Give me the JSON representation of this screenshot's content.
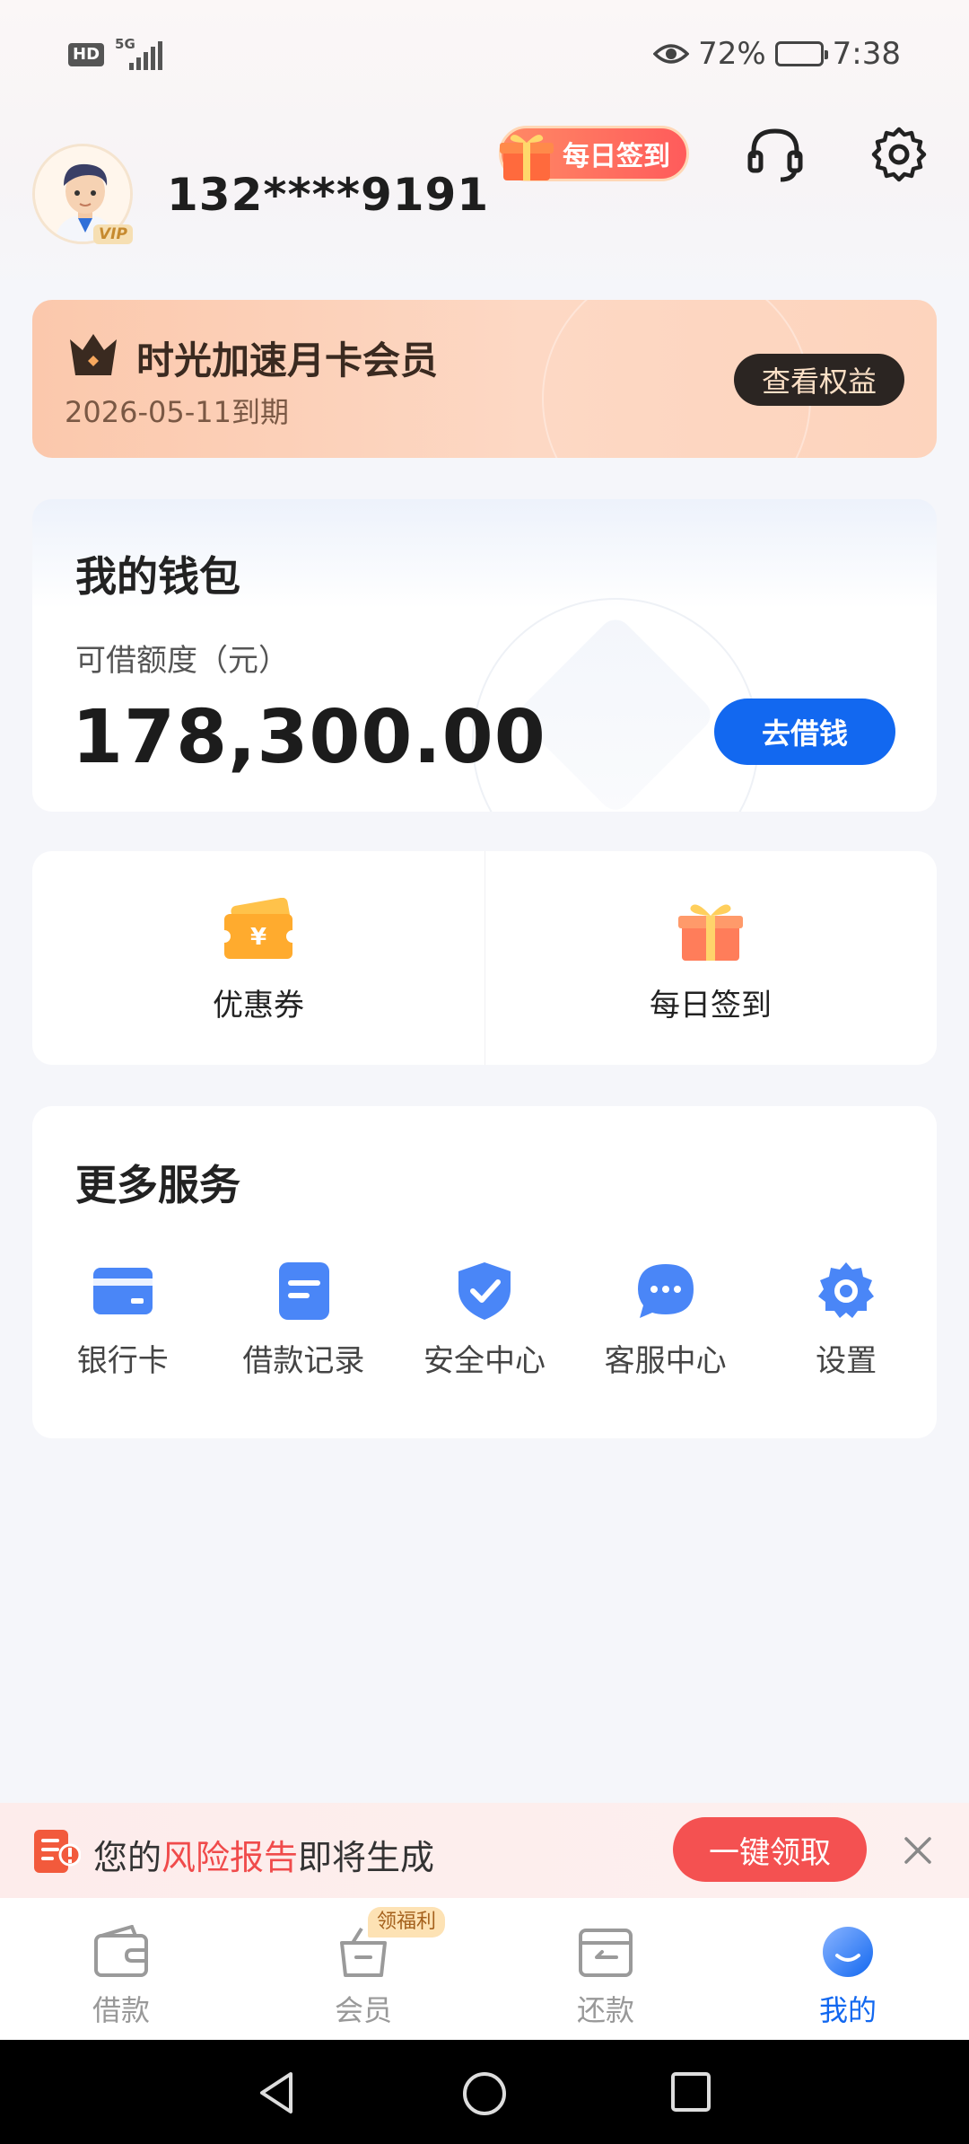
{
  "status_bar": {
    "hd": "HD",
    "network": "5G",
    "battery_percent": "72%",
    "time": "7:38",
    "battery_level": 0.72
  },
  "header": {
    "phone": "132****9191",
    "vip_tag": "VIP",
    "checkin_label": "每日签到"
  },
  "member": {
    "title": "时光加速月卡会员",
    "expire": "2026-05-11到期",
    "rights_button": "查看权益"
  },
  "wallet": {
    "title": "我的钱包",
    "credit_label": "可借额度（元）",
    "amount": "178,300.00",
    "borrow_button": "去借钱"
  },
  "quick": [
    {
      "label": "优惠券",
      "icon": "coupon-icon"
    },
    {
      "label": "每日签到",
      "icon": "gift-icon"
    }
  ],
  "services": {
    "title": "更多服务",
    "items": [
      {
        "label": "银行卡",
        "icon": "bank-card-icon"
      },
      {
        "label": "借款记录",
        "icon": "record-icon"
      },
      {
        "label": "安全中心",
        "icon": "shield-icon"
      },
      {
        "label": "客服中心",
        "icon": "chat-icon"
      },
      {
        "label": "设置",
        "icon": "gear-icon"
      }
    ]
  },
  "risk_banner": {
    "prefix": "您的",
    "highlight": "风险报告",
    "suffix": "即将生成",
    "claim_button": "一键领取"
  },
  "bottom_nav": {
    "items": [
      {
        "label": "借款",
        "icon": "wallet-icon"
      },
      {
        "label": "会员",
        "icon": "basket-icon",
        "badge": "领福利"
      },
      {
        "label": "还款",
        "icon": "repay-icon"
      },
      {
        "label": "我的",
        "icon": "profile-icon"
      }
    ],
    "active": "我的"
  },
  "colors": {
    "primary": "#1268f0",
    "accent_red": "#f04b4b",
    "member_bg": "#fbc8ac",
    "background": "#f5f6fa"
  }
}
